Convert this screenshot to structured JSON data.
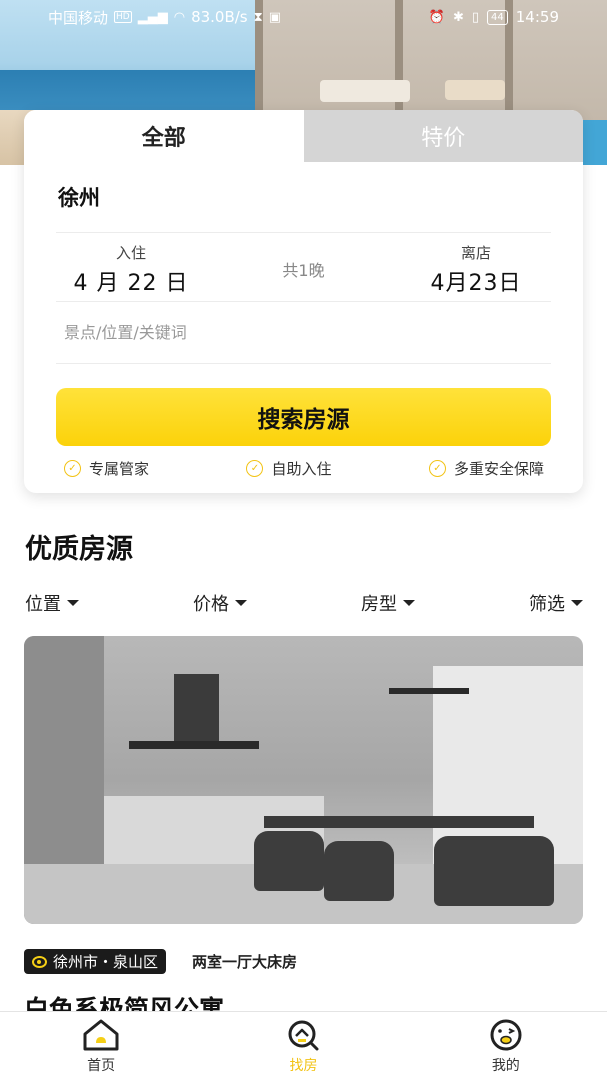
{
  "status_bar": {
    "carrier": "中国移动",
    "network_badge": "HD",
    "signal": "4G",
    "speed": "83.0B/s",
    "battery": "44",
    "time": "14:59"
  },
  "tabs": [
    {
      "label": "全部",
      "active": true
    },
    {
      "label": "特价",
      "active": false
    }
  ],
  "search": {
    "city": "徐州",
    "checkin_label": "入住",
    "checkin_date": "4 月 22 日",
    "nights": "共1晚",
    "checkout_label": "离店",
    "checkout_date": "4月23日",
    "keyword_placeholder": "景点/位置/关键词",
    "button_label": "搜索房源",
    "features": [
      "专属管家",
      "自助入住",
      "多重安全保障"
    ]
  },
  "section": {
    "title": "优质房源",
    "filters": [
      "位置",
      "价格",
      "房型",
      "筛选"
    ]
  },
  "listing": {
    "location": "徐州市・泉山区",
    "room_type": "两室一厅大床房",
    "title": "白色系极简风公寓"
  },
  "bottom_nav": [
    {
      "label": "首页",
      "icon": "home-icon",
      "active": false
    },
    {
      "label": "找房",
      "icon": "search-house-icon",
      "active": true
    },
    {
      "label": "我的",
      "icon": "face-icon",
      "active": false
    }
  ],
  "colors": {
    "accent": "#FBD20A",
    "accent_text": "#F2C316",
    "inactive_tab": "#D5D5D5"
  }
}
